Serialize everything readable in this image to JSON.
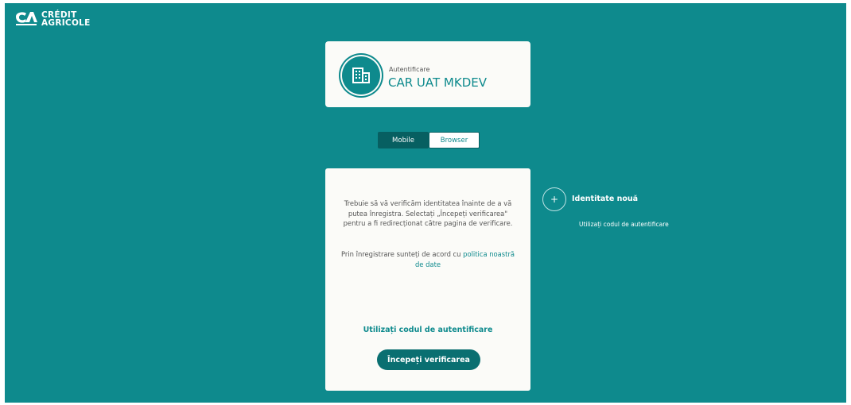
{
  "brand": {
    "line1": "CRÉDIT",
    "line2": "AGRICOLE"
  },
  "identity": {
    "small_label": "Autentificare",
    "title": "CAR UAT MKDEV"
  },
  "toggle": {
    "mobile": "Mobile",
    "browser": "Browser",
    "selected": "Mobile"
  },
  "main": {
    "info": "Trebuie să vă verificăm identitatea înainte de a vă putea înregistra. Selectați „Începeți verificarea\" pentru a fi redirecționat către pagina de verificare.",
    "policy_prefix": "Prin înregistrare sunteți de acord cu ",
    "policy_link": "politica noastră de date",
    "auth_code_link": "Utilizați codul de autentificare",
    "start_button": "Începeți verificarea"
  },
  "side": {
    "plus": "+",
    "new_identity": "Identitate nouă",
    "use_code": "Utilizați codul de autentificare"
  },
  "colors": {
    "teal": "#0e8a8d",
    "dark_teal": "#075f61",
    "card": "#fbfbf8"
  }
}
